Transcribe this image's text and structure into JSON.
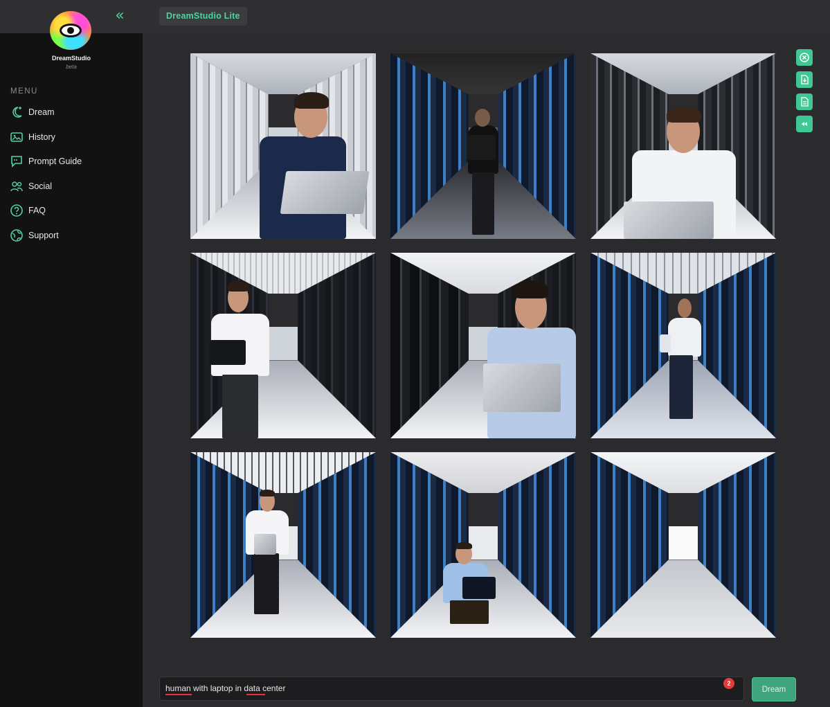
{
  "header": {
    "collapse_icon": "double-chevron-left-icon",
    "product_tab": "DreamStudio Lite"
  },
  "sidebar": {
    "brand": "DreamStudio",
    "beta": "beta",
    "menu_label": "MENU",
    "items": [
      {
        "label": "Dream",
        "icon": "moon-sparkle-icon"
      },
      {
        "label": "History",
        "icon": "image-gallery-icon"
      },
      {
        "label": "Prompt Guide",
        "icon": "speech-bubble-icon"
      },
      {
        "label": "Social",
        "icon": "people-icon"
      },
      {
        "label": "FAQ",
        "icon": "question-circle-icon"
      },
      {
        "label": "Support",
        "icon": "globe-support-icon"
      }
    ]
  },
  "gallery": {
    "images": [
      {
        "name": "generated-image-1"
      },
      {
        "name": "generated-image-2"
      },
      {
        "name": "generated-image-3"
      },
      {
        "name": "generated-image-4"
      },
      {
        "name": "generated-image-5"
      },
      {
        "name": "generated-image-6"
      },
      {
        "name": "generated-image-7"
      },
      {
        "name": "generated-image-8"
      },
      {
        "name": "generated-image-9"
      }
    ]
  },
  "tools": [
    {
      "icon": "close-circle-icon"
    },
    {
      "icon": "download-file-icon"
    },
    {
      "icon": "document-icon"
    },
    {
      "icon": "rewind-icon"
    }
  ],
  "prompt": {
    "value": "human with laptop in data center",
    "notification_count": "2",
    "dream_button": "Dream"
  },
  "colors": {
    "accent": "#4fd1a1",
    "button": "#3fa57f",
    "badge": "#e23b3b"
  }
}
